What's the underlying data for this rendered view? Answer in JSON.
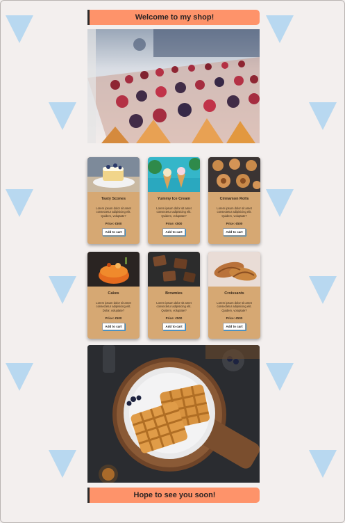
{
  "header": {
    "title": "Welcome to my shop!"
  },
  "footer": {
    "title": "Hope to see you soon!"
  },
  "products": [
    {
      "name": "Tasty Scones",
      "desc": "Lorem ipsum dolor sit amet consectetur adipisicing elit. Quidem, voluptate?",
      "price": "Price: €500",
      "cta": "Add to cart"
    },
    {
      "name": "Yummy Ice Cream",
      "desc": "Lorem ipsum dolor sit amet consectetur adipisicing elit. Quidem, voluptate?",
      "price": "Price: €500",
      "cta": "Add to cart"
    },
    {
      "name": "Cinnamon Rolls",
      "desc": "Lorem ipsum dolor sit amet consectetur adipisicing elit. Quidem, voluptate?",
      "price": "Price: €500",
      "cta": "Add to cart"
    },
    {
      "name": "Cakes",
      "desc": "Lorem ipsum dolor sit amet consectetur adipisicing elit. Dolor, voluptate?",
      "price": "Price: €500",
      "cta": "Add to cart"
    },
    {
      "name": "Brownies",
      "desc": "Lorem ipsum dolor sit amet consectetur adipisicing elit. Quidem, voluptate?",
      "price": "Price: €500",
      "cta": "Add to cart"
    },
    {
      "name": "Croissants",
      "desc": "Lorem ipsum dolor sit amet consectetur adipisicing elit. Quidem, voluptate?",
      "price": "Price: €500",
      "cta": "Add to cart"
    }
  ],
  "colors": {
    "banner": "#fe936a",
    "card": "#d6a873",
    "background": "#f3efee",
    "triangle": "#b8d8f0"
  }
}
